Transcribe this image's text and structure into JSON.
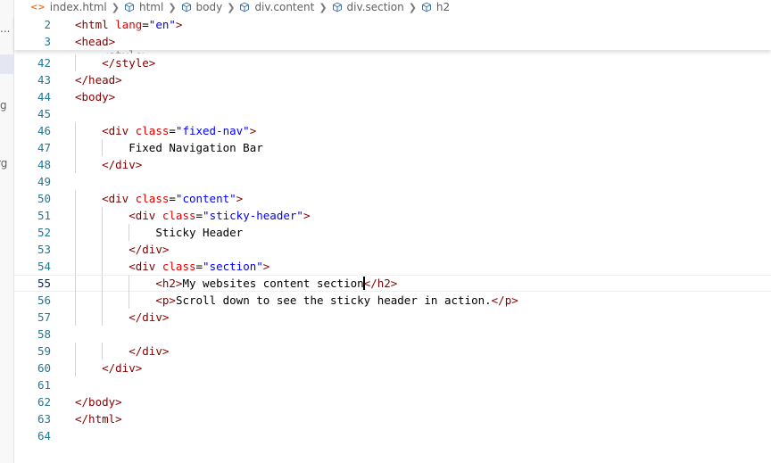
{
  "breadcrumb": [
    {
      "label": "index.html",
      "icon": "html-file-icon"
    },
    {
      "label": "html",
      "icon": "element-icon"
    },
    {
      "label": "body",
      "icon": "element-icon"
    },
    {
      "label": "div.content",
      "icon": "element-icon"
    },
    {
      "label": "div.section",
      "icon": "element-icon"
    },
    {
      "label": "h2",
      "icon": "element-icon"
    }
  ],
  "sidebar": {
    "glyphs": [
      "...",
      "g",
      "rg"
    ]
  },
  "sticky_scroll": [
    {
      "line": "2",
      "tokens": [
        [
          "t",
          "<html "
        ],
        [
          "a",
          "lang"
        ],
        [
          "x",
          "="
        ],
        [
          "v",
          "\"en\""
        ],
        [
          "t",
          ">"
        ]
      ]
    },
    {
      "line": "3",
      "tokens": [
        [
          "t",
          "<head>"
        ]
      ]
    }
  ],
  "hidden_line_fragment": "<style>",
  "lines": [
    {
      "line": "42",
      "indent": 1,
      "tokens": [
        [
          "t",
          "</style>"
        ]
      ]
    },
    {
      "line": "43",
      "indent": 0,
      "tokens": [
        [
          "t",
          "</head>"
        ]
      ]
    },
    {
      "line": "44",
      "indent": 0,
      "tokens": [
        [
          "t",
          "<body>"
        ]
      ]
    },
    {
      "line": "45",
      "indent": 0,
      "tokens": []
    },
    {
      "line": "46",
      "indent": 1,
      "tokens": [
        [
          "t",
          "<div "
        ],
        [
          "a",
          "class"
        ],
        [
          "x",
          "="
        ],
        [
          "v",
          "\"fixed-nav\""
        ],
        [
          "t",
          ">"
        ]
      ]
    },
    {
      "line": "47",
      "indent": 2,
      "tokens": [
        [
          "x",
          "Fixed Navigation Bar"
        ]
      ]
    },
    {
      "line": "48",
      "indent": 1,
      "tokens": [
        [
          "t",
          "</div>"
        ]
      ]
    },
    {
      "line": "49",
      "indent": 0,
      "tokens": []
    },
    {
      "line": "50",
      "indent": 1,
      "tokens": [
        [
          "t",
          "<div "
        ],
        [
          "a",
          "class"
        ],
        [
          "x",
          "="
        ],
        [
          "v",
          "\"content\""
        ],
        [
          "t",
          ">"
        ]
      ]
    },
    {
      "line": "51",
      "indent": 2,
      "tokens": [
        [
          "t",
          "<div "
        ],
        [
          "a",
          "class"
        ],
        [
          "x",
          "="
        ],
        [
          "v",
          "\"sticky-header\""
        ],
        [
          "t",
          ">"
        ]
      ]
    },
    {
      "line": "52",
      "indent": 3,
      "tokens": [
        [
          "x",
          "Sticky Header"
        ]
      ]
    },
    {
      "line": "53",
      "indent": 2,
      "tokens": [
        [
          "t",
          "</div>"
        ]
      ]
    },
    {
      "line": "54",
      "indent": 2,
      "tokens": [
        [
          "t",
          "<div "
        ],
        [
          "a",
          "class"
        ],
        [
          "x",
          "="
        ],
        [
          "v",
          "\"section\""
        ],
        [
          "t",
          ">"
        ]
      ]
    },
    {
      "line": "55",
      "indent": 3,
      "current": true,
      "tokens": [
        [
          "t",
          "<h2>"
        ],
        [
          "x",
          "My websites content section"
        ],
        [
          "cursor",
          ""
        ],
        [
          "t",
          "</h2>"
        ]
      ]
    },
    {
      "line": "56",
      "indent": 3,
      "tokens": [
        [
          "t",
          "<p>"
        ],
        [
          "x",
          "Scroll down to see the sticky header in action."
        ],
        [
          "t",
          "</p>"
        ]
      ]
    },
    {
      "line": "57",
      "indent": 2,
      "tokens": [
        [
          "t",
          "</div>"
        ]
      ]
    },
    {
      "line": "58",
      "indent": 0,
      "tokens": []
    },
    {
      "line": "59",
      "indent": 2,
      "tokens": [
        [
          "t",
          "</div>"
        ]
      ]
    },
    {
      "line": "60",
      "indent": 1,
      "tokens": [
        [
          "t",
          "</div>"
        ]
      ]
    },
    {
      "line": "61",
      "indent": 0,
      "tokens": []
    },
    {
      "line": "62",
      "indent": 0,
      "tokens": [
        [
          "t",
          "</body>"
        ]
      ]
    },
    {
      "line": "63",
      "indent": 0,
      "tokens": [
        [
          "t",
          "</html>"
        ]
      ]
    },
    {
      "line": "64",
      "indent": 0,
      "tokens": []
    }
  ],
  "colors": {
    "tag": "#800000",
    "attribute": "#e50000",
    "value": "#0000ff",
    "text": "#000000",
    "line_number": "#237893",
    "active_line_number": "#0b216f"
  }
}
